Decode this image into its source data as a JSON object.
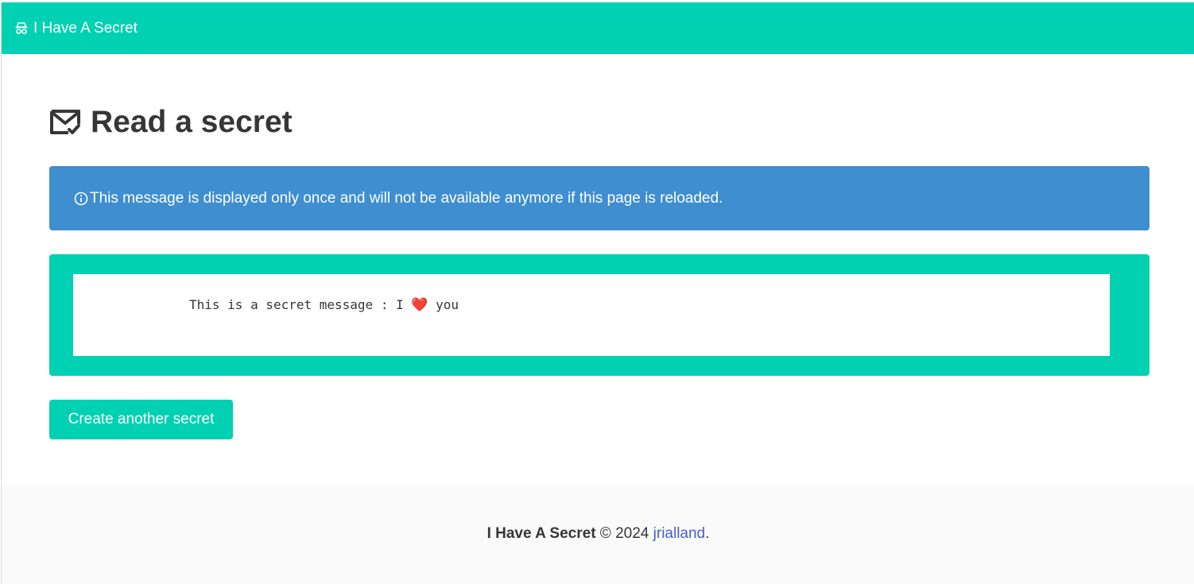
{
  "navbar": {
    "brand_icon": "user-secret-icon",
    "brand_label": "I Have A Secret"
  },
  "page": {
    "title_icon": "envelope-check-icon",
    "title": "Read a secret"
  },
  "notice": {
    "icon": "info-circle-icon",
    "text": "This message is displayed only once and will not be available anymore if this page is reloaded."
  },
  "secret": {
    "text_before": "This is a secret message : I ",
    "heart": "❤️",
    "text_after": " you"
  },
  "actions": {
    "create_label": "Create another secret"
  },
  "footer": {
    "brand": "I Have A Secret",
    "copyright": " © 2024 ",
    "author": "jrialland",
    "trailing": "."
  },
  "colors": {
    "primary": "#00d1b2",
    "info": "#3e8ed0",
    "link": "#485fc7",
    "footer_bg": "#fafafa"
  }
}
